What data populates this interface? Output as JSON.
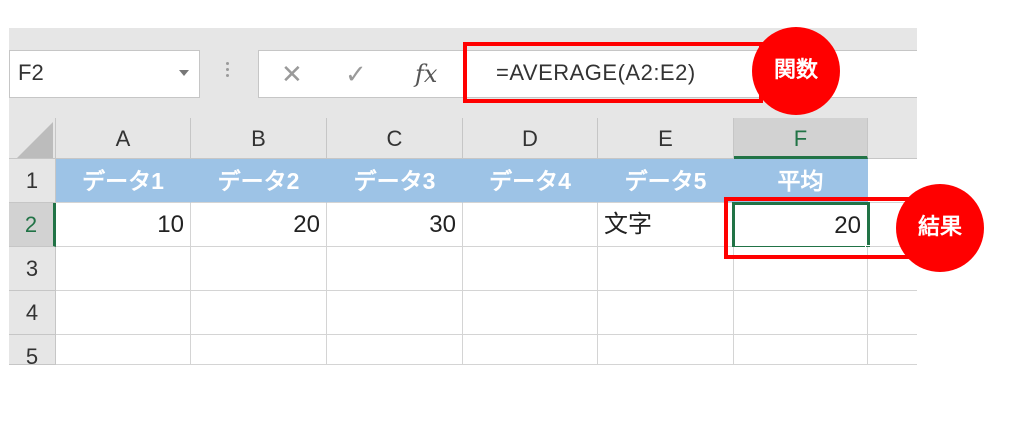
{
  "name_box": {
    "value": "F2"
  },
  "formula_bar": {
    "cancel_glyph": "✕",
    "enter_glyph": "✓",
    "fx_label": "fx",
    "formula": "=AVERAGE(A2:E2)"
  },
  "columns": [
    "A",
    "B",
    "C",
    "D",
    "E",
    "F"
  ],
  "active_column": "F",
  "rows": [
    "1",
    "2",
    "3",
    "4",
    "5"
  ],
  "active_row": "2",
  "row1": [
    "データ1",
    "データ2",
    "データ3",
    "データ4",
    "データ5",
    "平均"
  ],
  "row2": [
    "10",
    "20",
    "30",
    "",
    "文字",
    "20"
  ],
  "annotations": {
    "function_badge": "関数",
    "result_badge": "結果"
  },
  "colors": {
    "header_fill": "#9dc3e6",
    "accent_green": "#217346",
    "annotation_red": "#ff0000"
  }
}
